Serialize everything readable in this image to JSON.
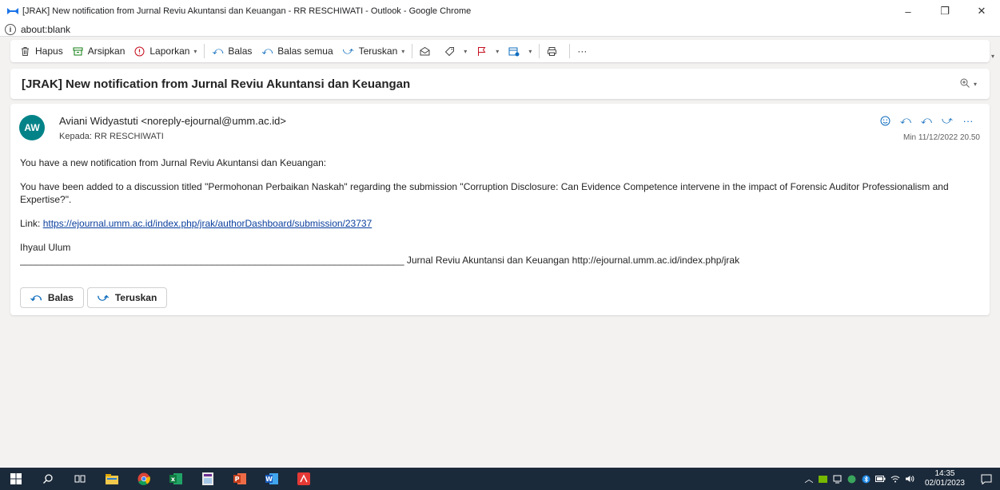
{
  "window": {
    "title": "[JRAK] New notification from Jurnal Reviu Akuntansi dan Keuangan - RR RESCHIWATI - Outlook - Google Chrome",
    "url": "about:blank",
    "controls": {
      "minimize": "–",
      "restore": "❐",
      "close": "✕"
    }
  },
  "toolbar": {
    "delete": "Hapus",
    "archive": "Arsipkan",
    "report": "Laporkan",
    "reply": "Balas",
    "reply_all": "Balas semua",
    "forward": "Teruskan",
    "more": "···"
  },
  "subject": "[JRAK] New notification from Jurnal Reviu Akuntansi dan Keuangan",
  "message": {
    "avatar_initials": "AW",
    "avatar_color": "#038387",
    "sender": "Aviani Widyastuti <noreply-ejournal@umm.ac.id>",
    "to": "Kepada:  RR RESCHIWATI",
    "date": "Min 11/12/2022 20.50",
    "body": {
      "line1": "You have a new notification from Jurnal Reviu Akuntansi dan Keuangan:",
      "line2": "You have been added to a discussion titled \"Permohonan Perbaikan Naskah\" regarding the submission \"Corruption Disclosure: Can Evidence Competence intervene in the impact of Forensic Auditor Professionalism and Expertise?\".",
      "link_label": "Link: ",
      "link_url": "https://ejournal.umm.ac.id/index.php/jrak/authorDashboard/submission/23737",
      "signature_name": "Ihyaul Ulum",
      "signature_line": "________________________________________________________________________ Jurnal Reviu Akuntansi dan Keuangan http://ejournal.umm.ac.id/index.php/jrak"
    },
    "reply_button": "Balas",
    "forward_button": "Teruskan"
  },
  "taskbar": {
    "time": "14:35",
    "date": "02/01/2023"
  },
  "colors": {
    "accent": "#0f6cbd",
    "taskbar": "#1b2a3a"
  }
}
